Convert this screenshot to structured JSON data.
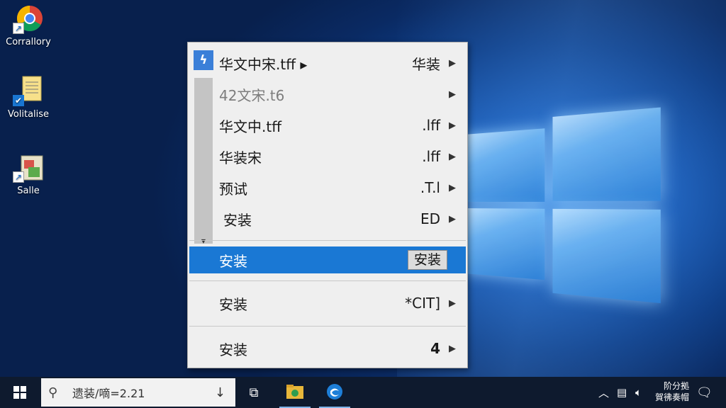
{
  "desktop": {
    "icons": [
      {
        "label": "Corrallory",
        "icon": "chrome-icon"
      },
      {
        "label": "Volitalise",
        "icon": "notepad-file-icon"
      },
      {
        "label": "Salle",
        "icon": "app-package-icon"
      }
    ]
  },
  "context_menu": {
    "items": [
      {
        "label": "华文中宋.tff ▸",
        "shortcut": "华装",
        "submenu": true
      },
      {
        "label": "42文宋.t6",
        "shortcut": "",
        "submenu": true,
        "disabled": true
      },
      {
        "label": "华文中.tff",
        "shortcut": ".lff",
        "submenu": true
      },
      {
        "label": "华装宋",
        "shortcut": ".lff",
        "submenu": true
      },
      {
        "label": "预试",
        "shortcut": ".T.l",
        "submenu": true
      },
      {
        "label": "安装",
        "shortcut": "ED",
        "submenu": true
      },
      {
        "label": "安装",
        "shortcut": "安装",
        "submenu": false,
        "highlighted": true
      },
      {
        "label": "安装",
        "shortcut": "*CIT]",
        "submenu": true
      },
      {
        "label": "安装",
        "shortcut": "4",
        "submenu": true
      }
    ],
    "highlight_color": "#1a78d4"
  },
  "taskbar": {
    "search_text": "遗装/嘀=2.21",
    "clock_line1": "阶分拠",
    "clock_line2": "賀彿奏帽"
  }
}
